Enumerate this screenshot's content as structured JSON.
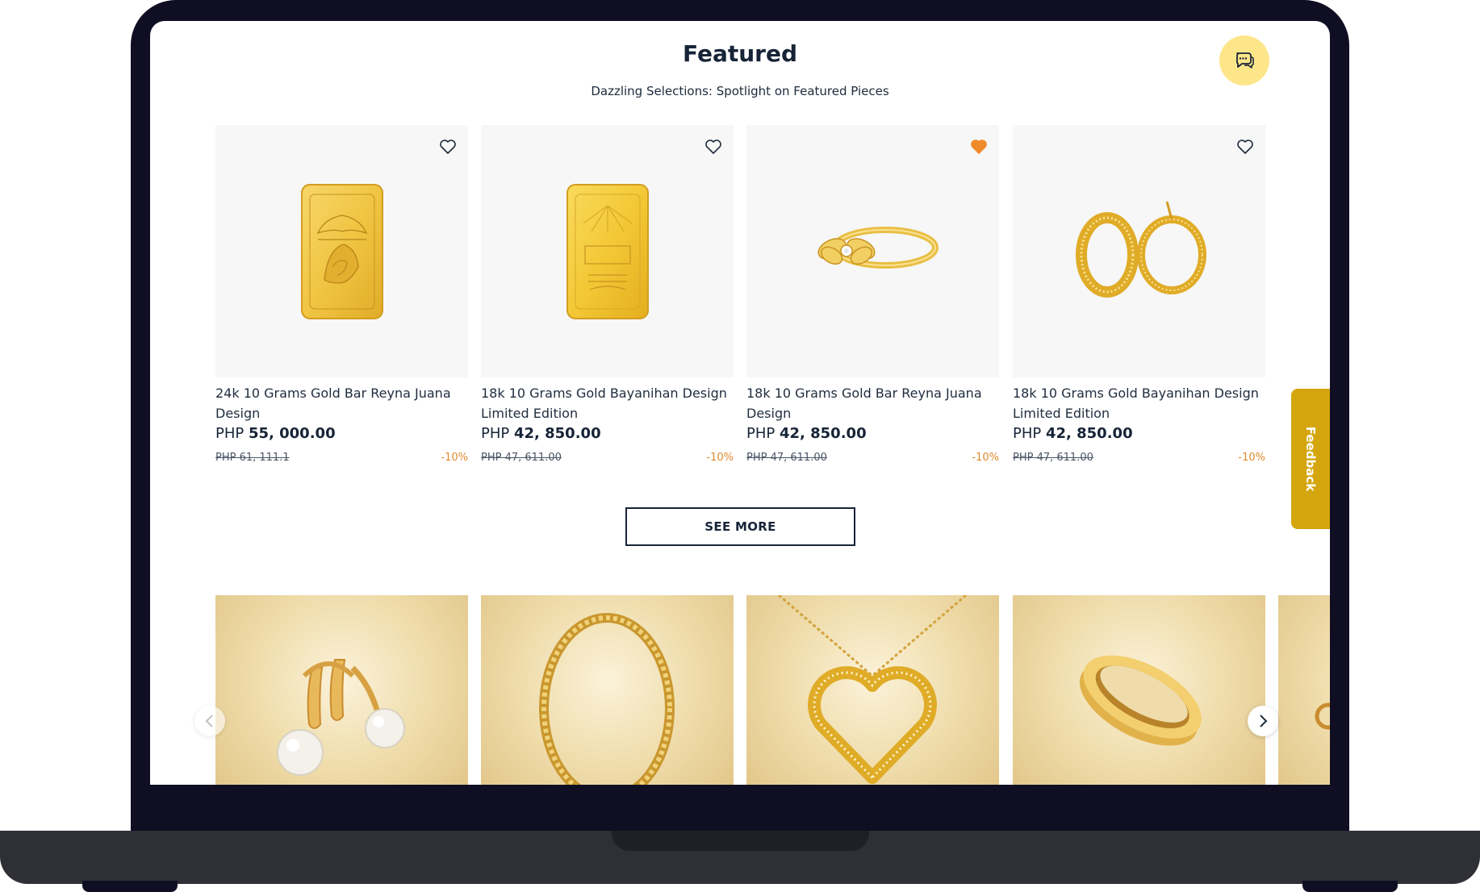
{
  "section": {
    "title": "Featured",
    "subtitle": "Dazzling Selections: Spotlight on Featured Pieces"
  },
  "products": [
    {
      "name": "24k 10 Grams Gold Bar Reyna Juana Design",
      "currency": "PHP",
      "price": "55, 000.00",
      "old_price": "PHP 61, 111.1",
      "discount": "-10%",
      "favorited": false,
      "image_icon": "gold-bar-icon"
    },
    {
      "name": "18k 10 Grams Gold Bayanihan Design Limited Edition",
      "currency": "PHP",
      "price": "42, 850.00",
      "old_price": "PHP 47, 611.00",
      "discount": "-10%",
      "favorited": false,
      "image_icon": "gold-bar-icon"
    },
    {
      "name": "18k 10 Grams Gold Bar Reyna Juana Design",
      "currency": "PHP",
      "price": "42, 850.00",
      "old_price": "PHP 47, 611.00",
      "discount": "-10%",
      "favorited": true,
      "image_icon": "ring-icon"
    },
    {
      "name": "18k 10 Grams Gold Bayanihan Design Limited Edition",
      "currency": "PHP",
      "price": "42, 850.00",
      "old_price": "PHP 47, 611.00",
      "discount": "-10%",
      "favorited": false,
      "image_icon": "hoop-earrings-icon"
    }
  ],
  "see_more_label": "SEE MORE",
  "feedback_label": "Feedback",
  "carousel": {
    "tiles": [
      "pearl-earrings-icon",
      "chain-bracelet-icon",
      "heart-necklace-icon",
      "gold-ring-icon",
      "jewelry-icon"
    ]
  },
  "colors": {
    "navy": "#172437",
    "accent_gold": "#d4a50d",
    "chat_bg": "#fde68a",
    "discount": "#e08a2c",
    "favorite": "#ef8a2a"
  }
}
